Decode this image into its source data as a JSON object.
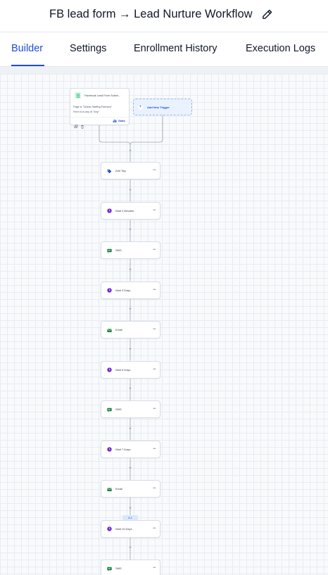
{
  "header": {
    "title": "FB lead form → Lead Nurture Workflow"
  },
  "tabs": [
    {
      "label": "Builder",
      "active": true
    },
    {
      "label": "Settings",
      "active": false
    },
    {
      "label": "Enrollment History",
      "active": false
    },
    {
      "label": "Execution Logs",
      "active": false
    }
  ],
  "trigger": {
    "title": "Facebook Lead Form Submi...",
    "line1": "Page is \"Global Staffing Partners\"",
    "line2": "Form is is any of \"Any\"",
    "stats_label": "Stats",
    "icon": "form-icon"
  },
  "add_trigger": {
    "label": "Add New Trigger"
  },
  "branch_badge": {
    "label": "A   1"
  },
  "steps": [
    {
      "label": "Add Tag",
      "icon": "tag-icon",
      "color": "#1d4ed8"
    },
    {
      "label": "Wait 2 Minutes",
      "icon": "clock-icon",
      "color": "#6d28d9"
    },
    {
      "label": "SMS",
      "icon": "sms-icon",
      "color": "#15803d"
    },
    {
      "label": "Wait 3 Days",
      "icon": "clock-icon",
      "color": "#6d28d9"
    },
    {
      "label": "Email",
      "icon": "email-icon",
      "color": "#15803d"
    },
    {
      "label": "Wait 5 Days",
      "icon": "clock-icon",
      "color": "#6d28d9"
    },
    {
      "label": "SMS",
      "icon": "sms-icon",
      "color": "#15803d"
    },
    {
      "label": "Wait 7 Days",
      "icon": "clock-icon",
      "color": "#6d28d9"
    },
    {
      "label": "Email",
      "icon": "email-icon",
      "color": "#15803d"
    },
    {
      "label": "Wait 10 Days",
      "icon": "clock-icon",
      "color": "#6d28d9"
    },
    {
      "label": "SMS",
      "icon": "sms-icon",
      "color": "#15803d"
    }
  ]
}
